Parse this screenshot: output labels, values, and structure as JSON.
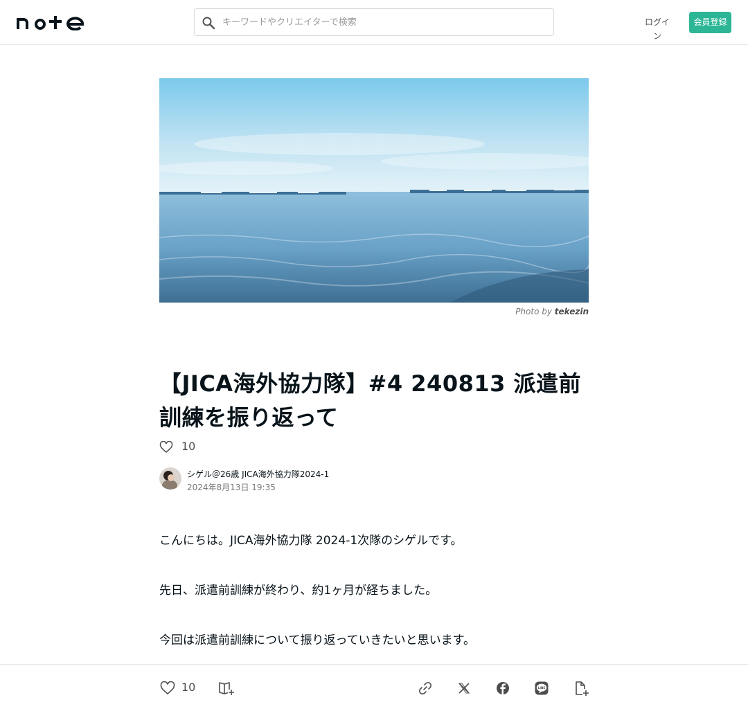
{
  "header": {
    "logo_text": "note",
    "search_placeholder": "キーワードやクリエイターで検索",
    "login_label": "ログイン",
    "signup_label": "会員登録"
  },
  "hero": {
    "photo_credit_prefix": "Photo by",
    "photo_credit_author": "tekezin"
  },
  "article": {
    "title": "【JICA海外協力隊】#4 240813 派遣前訓練を振り返って",
    "like_count": "10",
    "author_name": "シゲル＠26歳 JICA海外協力隊2024-1",
    "date": "2024年8月13日 19:35",
    "paragraphs": [
      "こんにちは。JICA海外協力隊 2024-1次隊のシゲルです。",
      "先日、派遣前訓練が終わり、約1ヶ月が経ちました。",
      "今回は派遣前訓練について振り返っていきたいと思います。"
    ]
  },
  "footer": {
    "like_count": "10",
    "icons": [
      "heart-icon",
      "magazine-add-icon",
      "link-icon",
      "x-icon",
      "facebook-icon",
      "line-icon",
      "embed-add-icon"
    ]
  },
  "colors": {
    "brand": "#2cb696",
    "text": "#08131a",
    "muted": "#777777"
  }
}
